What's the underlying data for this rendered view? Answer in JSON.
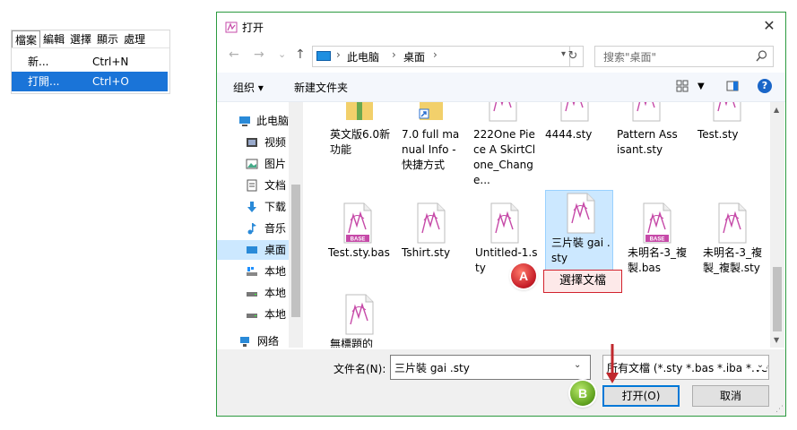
{
  "app_menu": {
    "menubar": [
      "檔案",
      "編輯",
      "選擇",
      "顯示",
      "處理"
    ],
    "items": [
      {
        "label": "新...",
        "shortcut": "Ctrl+N"
      },
      {
        "label": "打開...",
        "shortcut": "Ctrl+O"
      }
    ]
  },
  "dialog": {
    "title": "打开",
    "close_glyph": "✕",
    "nav": {
      "back": "←",
      "forward": "→",
      "dropdown": "⌄",
      "up": "↑"
    },
    "breadcrumb": [
      "此电脑",
      "桌面"
    ],
    "refresh_glyph": "↻",
    "search_placeholder": "搜索\"桌面\"",
    "toolbar": {
      "organize": "组织 ▾",
      "new_folder": "新建文件夹"
    },
    "help_label": "?",
    "nav_pane": [
      "此电脑",
      "视频",
      "图片",
      "文档",
      "下载",
      "音乐",
      "桌面",
      "本地",
      "本地",
      "本地",
      "网络"
    ],
    "files": [
      {
        "name": "英文版6.0新功能",
        "type": "folder"
      },
      {
        "name": "7.0 full manual Info - 快捷方式",
        "type": "shortcut"
      },
      {
        "name": "222One Piece A SkirtClone_Change...",
        "type": "sty"
      },
      {
        "name": "4444.sty",
        "type": "sty"
      },
      {
        "name": "Pattern Assisant.sty",
        "type": "sty"
      },
      {
        "name": "Test.sty",
        "type": "sty"
      },
      {
        "name": "Test.sty.bas",
        "type": "bas"
      },
      {
        "name": "Tshirt.sty",
        "type": "sty"
      },
      {
        "name": "Untitled-1.sty",
        "type": "sty"
      },
      {
        "name": "三片裝 gai .sty",
        "type": "sty",
        "selected": true
      },
      {
        "name": "未明名-3_複製.bas",
        "type": "bas"
      },
      {
        "name": "未明名-3_複製_複製.sty",
        "type": "sty"
      },
      {
        "name": "無標題的",
        "type": "sty"
      }
    ],
    "bas_label": "BASE",
    "filename_label": "文件名(N):",
    "filename_value": "三片裝 gai .sty",
    "filetype_value": "所有文檔 (*.sty *.bas *.iba *.vet",
    "open_button": "打开(O)",
    "cancel_button": "取消"
  },
  "callouts": {
    "a_badge": "A",
    "a_text": "選擇文檔",
    "b_badge": "B"
  },
  "colors": {
    "accent": "#1a74d8",
    "selection": "#cce8ff",
    "callout_red": "#d2222d",
    "callout_green": "#63a521",
    "dialog_border": "#2b9a3f"
  }
}
